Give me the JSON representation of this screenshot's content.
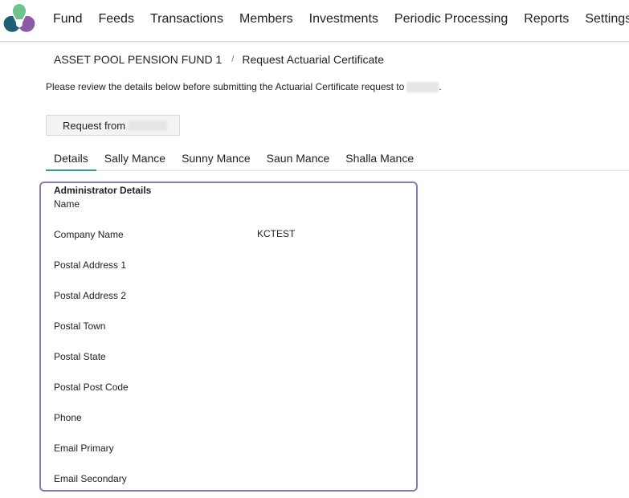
{
  "colors": {
    "accent": "#2e9e86",
    "panel_border": "#8e78b2",
    "logo_green": "#6ec28a",
    "logo_teal": "#1f5f73",
    "logo_purple": "#8a5aa6"
  },
  "nav": {
    "items": [
      "Fund",
      "Feeds",
      "Transactions",
      "Members",
      "Investments",
      "Periodic Processing",
      "Reports",
      "Settings"
    ]
  },
  "breadcrumb": {
    "fund": "ASSET POOL PENSION FUND 1",
    "separator": "/",
    "page": "Request Actuarial Certificate"
  },
  "instructions": {
    "text": "Please review the details below before submitting the Actuarial Certificate request to",
    "end": "."
  },
  "request_button": {
    "label": "Request from"
  },
  "tabs": [
    "Details",
    "Sally Mance",
    "Sunny Mance",
    "Saun Mance",
    "Shalla Mance"
  ],
  "administrator": {
    "title": "Administrator Details",
    "fields": [
      {
        "label": "Name",
        "value": ""
      },
      {
        "label": "Company Name",
        "value": "KCTEST"
      },
      {
        "label": "Postal Address 1",
        "value": ""
      },
      {
        "label": "Postal Address 2",
        "value": ""
      },
      {
        "label": "Postal Town",
        "value": ""
      },
      {
        "label": "Postal State",
        "value": ""
      },
      {
        "label": "Postal Post Code",
        "value": ""
      },
      {
        "label": "Phone",
        "value": ""
      },
      {
        "label": "Email Primary",
        "value": ""
      },
      {
        "label": "Email Secondary",
        "value": ""
      }
    ]
  }
}
